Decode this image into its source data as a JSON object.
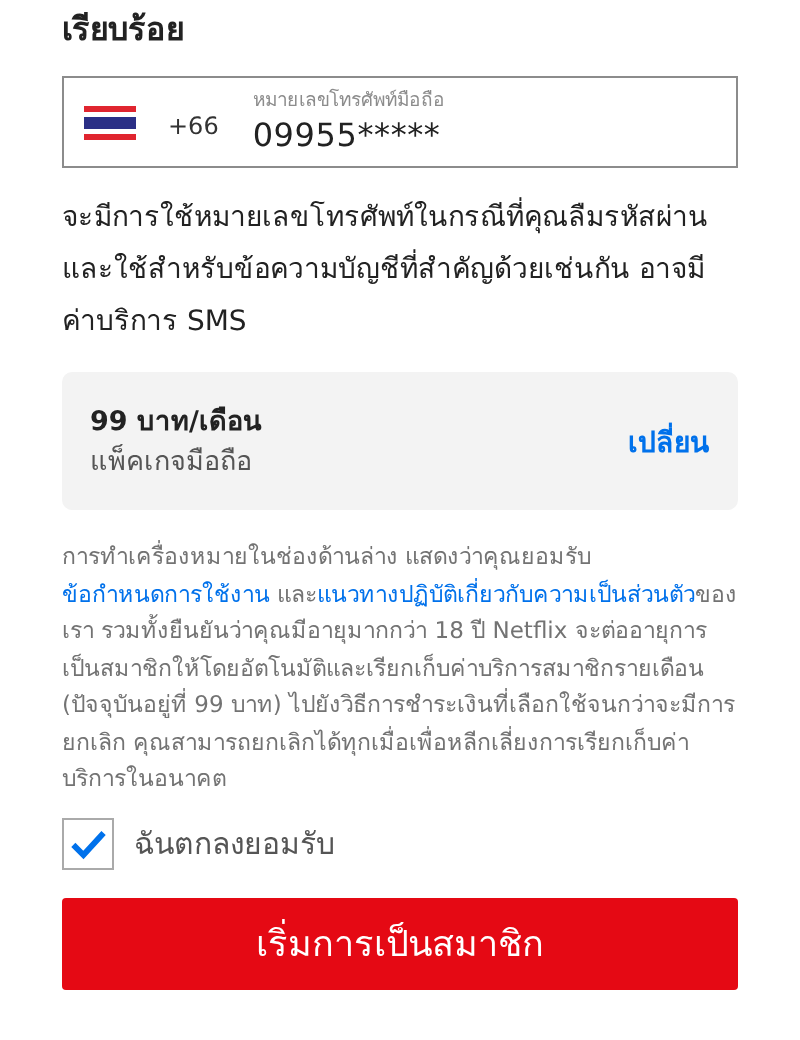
{
  "heading": "เรียบร้อย",
  "phone": {
    "country_code": "+66",
    "label": "หมายเลขโทรศัพท์มือถือ",
    "value": "09955*****"
  },
  "notice": "จะมีการใช้หมายเลขโทรศัพท์ในกรณีที่คุณลืมรหัสผ่านและใช้สำหรับข้อความบัญชีที่สำคัญด้วยเช่นกัน อาจมีค่าบริการ SMS",
  "plan": {
    "price": "99 บาท/เดือน",
    "name": "แพ็คเกจมือถือ",
    "change": "เปลี่ยน"
  },
  "legal": [
    {
      "kind": "text",
      "text": "การทำเครื่องหมายในช่องด้านล่าง แสดงว่าคุณยอมรับ"
    },
    {
      "kind": "link",
      "text": "ข้อกำหนดการใช้งาน"
    },
    {
      "kind": "text",
      "text": " และ"
    },
    {
      "kind": "link",
      "text": "แนวทางปฏิบัติเกี่ยวกับความเป็นส่วนตัว"
    },
    {
      "kind": "text",
      "text": "ของเรา รวมทั้งยืนยันว่าคุณมีอายุมากกว่า 18 ปี Netflix จะต่ออายุการเป็นสมาชิกให้โดยอัตโนมัติและเรียกเก็บค่าบริการสมาชิกรายเดือน (ปัจจุบันอยู่ที่ 99 บาท) ไปยังวิธีการชำระเงินที่เลือกใช้จนกว่าจะมีการยกเลิก คุณสามารถยกเลิกได้ทุกเมื่อเพื่อหลีกเลี่ยงการเรียกเก็บค่าบริการในอนาคต"
    }
  ],
  "agree": {
    "label": "ฉันตกลงยอมรับ",
    "checked": true
  },
  "submit": "เริ่มการเป็นสมาชิก"
}
